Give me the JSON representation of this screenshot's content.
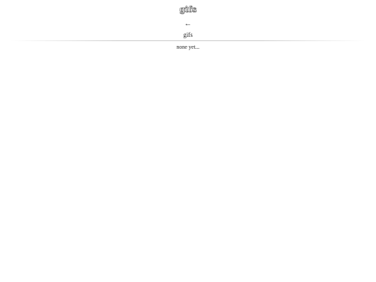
{
  "header": {
    "logo_text": "gifs",
    "back_arrow": "←"
  },
  "main": {
    "section_title": "gifs",
    "empty_message": "none yet..."
  }
}
